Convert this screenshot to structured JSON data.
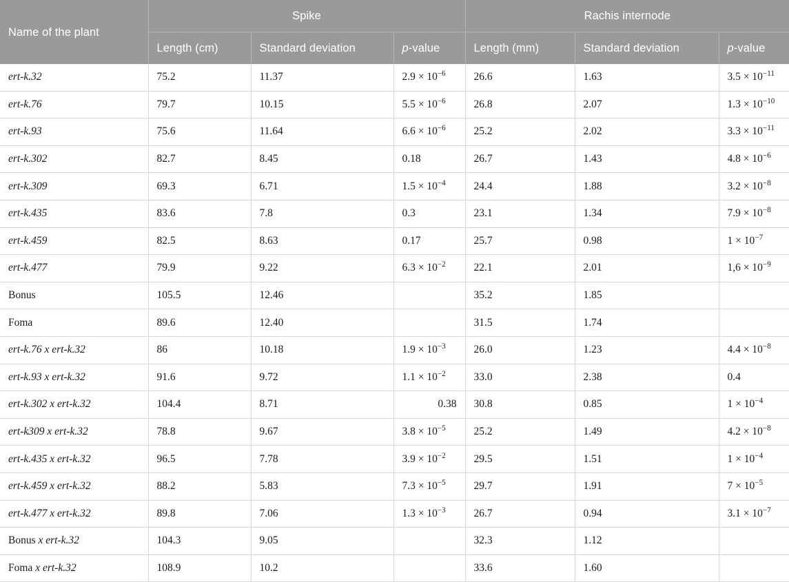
{
  "table": {
    "colors": {
      "header_bg": "#9a9a9a",
      "header_text": "#ffffff",
      "body_text": "#1a1a1a",
      "grid_line": "#d9d9d9",
      "header_grid_line": "#b4b4b4",
      "body_bg": "#ffffff"
    },
    "header": {
      "corner_blank": "",
      "groups": [
        {
          "label": "Spike",
          "span": 3
        },
        {
          "label": "Rachis internode",
          "span": 3
        }
      ],
      "columns": [
        {
          "key": "name",
          "label": "Name of the plant",
          "label_html": "Name of the plant"
        },
        {
          "key": "spike_len",
          "label": "Length (cm)",
          "label_html": "Length (cm)"
        },
        {
          "key": "spike_sd",
          "label": "Standard deviation",
          "label_html": "Standard deviation"
        },
        {
          "key": "spike_p",
          "label": "p-value",
          "label_html": "<i>p</i>-value"
        },
        {
          "key": "rachis_len",
          "label": "Length (mm)",
          "label_html": "Length (mm)"
        },
        {
          "key": "rachis_sd",
          "label": "Standard deviation",
          "label_html": "Standard deviation"
        },
        {
          "key": "rachis_p",
          "label": "p-value",
          "label_html": "<i>p</i>-value"
        }
      ]
    },
    "rows": [
      {
        "name": "ert-k.32",
        "name_style": "italic",
        "spike_len": "75.2",
        "spike_sd": "11.37",
        "spike_p": "2.9 × 10<sup>−6</sup>",
        "spike_p_text": "2.9 × 10⁻⁶",
        "rachis_len": "26.6",
        "rachis_sd": "1.63",
        "rachis_p": "3.5 × 10<sup>−11</sup>",
        "rachis_p_text": "3.5 × 10⁻¹¹"
      },
      {
        "name": "ert-k.76",
        "name_style": "italic",
        "spike_len": "79.7",
        "spike_sd": "10.15",
        "spike_p": "5.5 × 10<sup>−6</sup>",
        "spike_p_text": "5.5 × 10⁻⁶",
        "rachis_len": "26.8",
        "rachis_sd": "2.07",
        "rachis_p": "1.3 × 10<sup>−10</sup>",
        "rachis_p_text": "1.3 × 10⁻¹⁰"
      },
      {
        "name": "ert-k.93",
        "name_style": "italic",
        "spike_len": "75.6",
        "spike_sd": "11.64",
        "spike_p": "6.6 × 10<sup>−6</sup>",
        "spike_p_text": "6.6 × 10⁻⁶",
        "rachis_len": "25.2",
        "rachis_sd": "2.02",
        "rachis_p": "3.3 × 10<sup>−11</sup>",
        "rachis_p_text": "3.3 × 10⁻¹¹"
      },
      {
        "name": "ert-k.302",
        "name_style": "italic",
        "spike_len": "82.7",
        "spike_sd": "8.45",
        "spike_p": "0.18",
        "spike_p_text": "0.18",
        "rachis_len": "26.7",
        "rachis_sd": "1.43",
        "rachis_p": "4.8 × 10<sup>−6</sup>",
        "rachis_p_text": "4.8 × 10⁻⁶"
      },
      {
        "name": "ert-k.309",
        "name_style": "italic",
        "spike_len": "69.3",
        "spike_sd": "6.71",
        "spike_p": "1.5 × 10<sup>−4</sup>",
        "spike_p_text": "1.5 × 10⁻⁴",
        "rachis_len": "24.4",
        "rachis_sd": "1.88",
        "rachis_p": "3.2 × 10<sup>−8</sup>",
        "rachis_p_text": "3.2 × 10⁻⁸"
      },
      {
        "name": "ert-k.435",
        "name_style": "italic",
        "spike_len": "83.6",
        "spike_sd": "7.8",
        "spike_p": "0.3",
        "spike_p_text": "0.3",
        "rachis_len": "23.1",
        "rachis_sd": "1.34",
        "rachis_p": "7.9 × 10<sup>−8</sup>",
        "rachis_p_text": "7.9 × 10⁻⁸"
      },
      {
        "name": "ert-k.459",
        "name_style": "italic",
        "spike_len": "82.5",
        "spike_sd": "8.63",
        "spike_p": "0.17",
        "spike_p_text": "0.17",
        "rachis_len": "25.7",
        "rachis_sd": "0.98",
        "rachis_p": "1 × 10<sup>−7</sup>",
        "rachis_p_text": "1 × 10⁻⁷"
      },
      {
        "name": "ert-k.477",
        "name_style": "italic",
        "spike_len": "79.9",
        "spike_sd": "9.22",
        "spike_p": "6.3 × 10<sup>−2</sup>",
        "spike_p_text": "6.3 × 10⁻²",
        "rachis_len": "22.1",
        "rachis_sd": "2.01",
        "rachis_p": "1,6 × 10<sup>−9</sup>",
        "rachis_p_text": "1,6 × 10⁻⁹"
      },
      {
        "name": "Bonus",
        "name_style": "roman",
        "spike_len": "105.5",
        "spike_sd": "12.46",
        "spike_p": "",
        "spike_p_text": "",
        "rachis_len": "35.2",
        "rachis_sd": "1.85",
        "rachis_p": "",
        "rachis_p_text": ""
      },
      {
        "name": "Foma",
        "name_style": "roman",
        "spike_len": "89.6",
        "spike_sd": "12.40",
        "spike_p": "",
        "spike_p_text": "",
        "rachis_len": "31.5",
        "rachis_sd": "1.74",
        "rachis_p": "",
        "rachis_p_text": ""
      },
      {
        "name": "ert-k.76 x ert-k.32",
        "name_style": "italic",
        "spike_len": "86",
        "spike_sd": "10.18",
        "spike_p": "1.9 × 10<sup>−3</sup>",
        "spike_p_text": "1.9 × 10⁻³",
        "rachis_len": "26.0",
        "rachis_sd": "1.23",
        "rachis_p": "4.4 × 10<sup>−8</sup>",
        "rachis_p_text": "4.4 × 10⁻⁸"
      },
      {
        "name": "ert-k.93 x ert-k.32",
        "name_style": "italic",
        "spike_len": "91.6",
        "spike_sd": "9.72",
        "spike_p": "1.1 × 10<sup>−2</sup>",
        "spike_p_text": "1.1 × 10⁻²",
        "rachis_len": "33.0",
        "rachis_sd": "2.38",
        "rachis_p": "0.4",
        "rachis_p_text": "0.4"
      },
      {
        "name": "ert-k.302 x ert-k.32",
        "name_style": "italic",
        "spike_len": "104.4",
        "spike_sd": "8.71",
        "spike_p": "0.38",
        "spike_p_text": "0.38",
        "spike_p_align": "right",
        "rachis_len": "30.8",
        "rachis_sd": "0.85",
        "rachis_p": "1 × 10<sup>−4</sup>",
        "rachis_p_text": "1 × 10⁻⁴"
      },
      {
        "name": "ert-k309 x ert-k.32",
        "name_style": "italic",
        "spike_len": "78.8",
        "spike_sd": "9.67",
        "spike_p": "3.8 × 10<sup>−5</sup>",
        "spike_p_text": "3.8 × 10⁻⁵",
        "rachis_len": "25.2",
        "rachis_sd": "1.49",
        "rachis_p": "4.2 × 10<sup>−8</sup>",
        "rachis_p_text": "4.2 × 10⁻⁸"
      },
      {
        "name": "ert-k.435 x ert-k.32",
        "name_style": "italic",
        "spike_len": "96.5",
        "spike_sd": "7.78",
        "spike_p": "3.9 × 10<sup>−2</sup>",
        "spike_p_text": "3.9 × 10⁻²",
        "rachis_len": "29.5",
        "rachis_sd": "1.51",
        "rachis_p": "1 × 10<sup>−4</sup>",
        "rachis_p_text": "1 × 10⁻⁴"
      },
      {
        "name": "ert-k.459 x ert-k.32",
        "name_style": "italic",
        "spike_len": "88.2",
        "spike_sd": "5.83",
        "spike_p": "7.3 × 10<sup>−5</sup>",
        "spike_p_text": "7.3 × 10⁻⁵",
        "rachis_len": "29.7",
        "rachis_sd": "1.91",
        "rachis_p": "7 × 10<sup>−5</sup>",
        "rachis_p_text": "7 × 10⁻⁵"
      },
      {
        "name": "ert-k.477 x ert-k.32",
        "name_style": "italic",
        "spike_len": "89.8",
        "spike_sd": "7.06",
        "spike_p": "1.3 × 10<sup>−3</sup>",
        "spike_p_text": "1.3 × 10⁻³",
        "rachis_len": "26.7",
        "rachis_sd": "0.94",
        "rachis_p": "3.1 × 10<sup>−7</sup>",
        "rachis_p_text": "3.1 × 10⁻⁷"
      },
      {
        "name": "Bonus x ert-k.32",
        "name_style": "mixed",
        "name_roman_part": "Bonus ",
        "name_italic_part": "x ert-k.32",
        "spike_len": "104.3",
        "spike_sd": "9.05",
        "spike_p": "",
        "spike_p_text": "",
        "rachis_len": "32.3",
        "rachis_sd": "1.12",
        "rachis_p": "",
        "rachis_p_text": ""
      },
      {
        "name": "Foma x ert-k.32",
        "name_style": "mixed",
        "name_roman_part": "Foma ",
        "name_italic_part": "x ert-k.32",
        "spike_len": "108.9",
        "spike_sd": "10.2",
        "spike_p": "",
        "spike_p_text": "",
        "rachis_len": "33.6",
        "rachis_sd": "1.60",
        "rachis_p": "",
        "rachis_p_text": ""
      }
    ]
  }
}
